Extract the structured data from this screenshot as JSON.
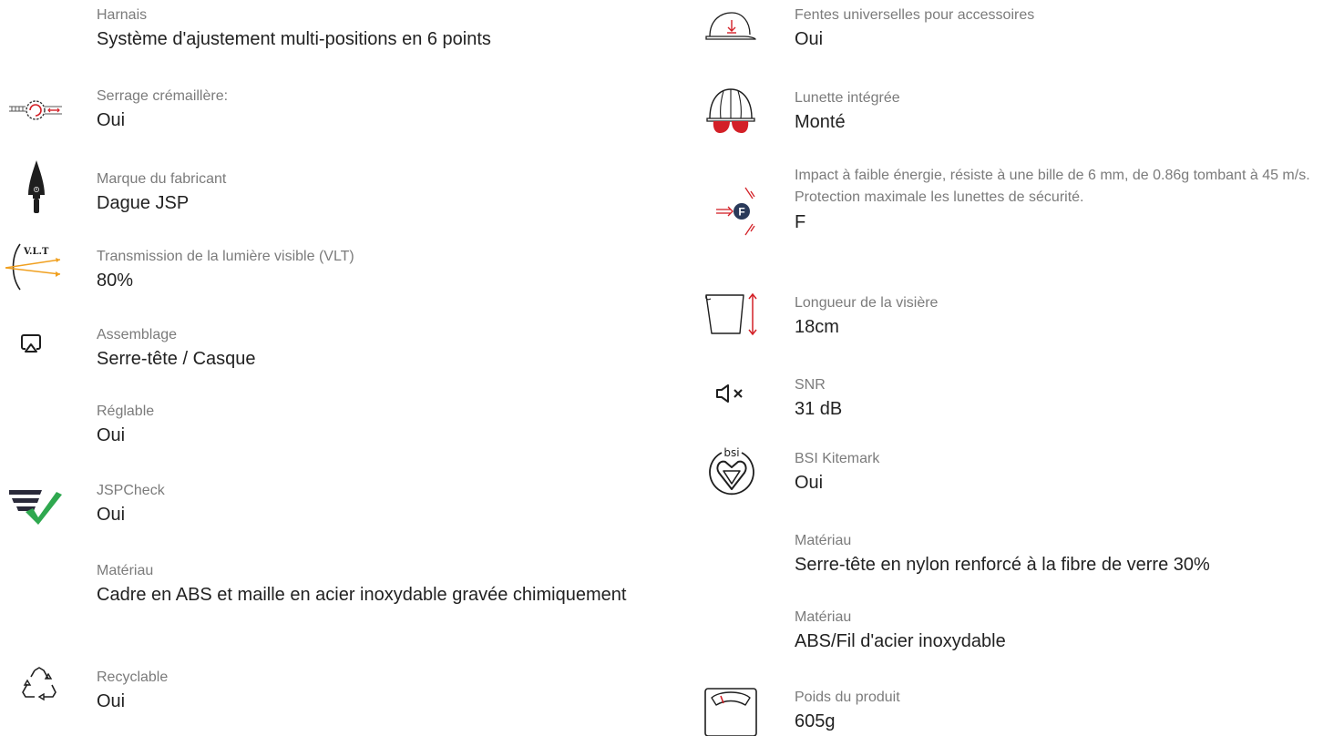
{
  "left_specs": [
    {
      "label": "Harnais",
      "value": "Système d'ajustement multi-positions en 6 points",
      "icon": ""
    },
    {
      "label": "Serrage crémaillère:",
      "value": "Oui",
      "icon": "ratchet-icon"
    },
    {
      "label": "Marque du fabricant",
      "value": "Dague JSP",
      "icon": "dagger-icon"
    },
    {
      "label": "Transmission de la lumière visible (VLT)",
      "value": "80%",
      "icon": "vlt-icon",
      "icon_text": "V.L.T"
    },
    {
      "label": "Assemblage",
      "value": "Serre-tête / Casque",
      "icon": "assembly-icon"
    },
    {
      "label": "Réglable",
      "value": "Oui",
      "icon": ""
    },
    {
      "label": "JSPCheck",
      "value": "Oui",
      "icon": "jspcheck-icon"
    },
    {
      "label": "Matériau",
      "value": "Cadre en ABS et maille en acier inoxydable gravée chimiquement",
      "icon": ""
    },
    {
      "label": "Recyclable",
      "value": "Oui",
      "icon": "recycle-icon"
    }
  ],
  "right_specs": [
    {
      "label": "Fentes universelles pour accessoires",
      "value": "Oui",
      "icon": "helmet-slot-icon"
    },
    {
      "label": "Lunette intégrée",
      "value": "Monté",
      "icon": "helmet-goggles-icon"
    },
    {
      "label": "Impact à faible énergie, résiste à une bille de 6 mm, de 0.86g tombant à 45 m/s. Protection maximale les lunettes de sécurité.",
      "value": "F",
      "icon": "impact-f-icon",
      "icon_text": "F"
    },
    {
      "label": "Longueur de la visière",
      "value": "18cm",
      "icon": "visor-length-icon"
    },
    {
      "label": "SNR",
      "value": "31 dB",
      "icon": "muted-speaker-icon"
    },
    {
      "label": "BSI Kitemark",
      "value": "Oui",
      "icon": "bsi-kitemark-icon",
      "icon_text": "bsi"
    },
    {
      "label": "Matériau",
      "value": "Serre-tête en nylon renforcé à la fibre de verre 30%",
      "icon": ""
    },
    {
      "label": "Matériau",
      "value": "ABS/Fil d'acier inoxydable",
      "icon": ""
    },
    {
      "label": "Poids du produit",
      "value": "605g",
      "icon": "weight-scale-icon"
    }
  ],
  "colors": {
    "label": "#7b7b7b",
    "value": "#222222",
    "accent_red": "#d32027",
    "check_green": "#2fa84f",
    "vlt_orange": "#f0a020",
    "icon_dark": "#1e1e1e"
  }
}
